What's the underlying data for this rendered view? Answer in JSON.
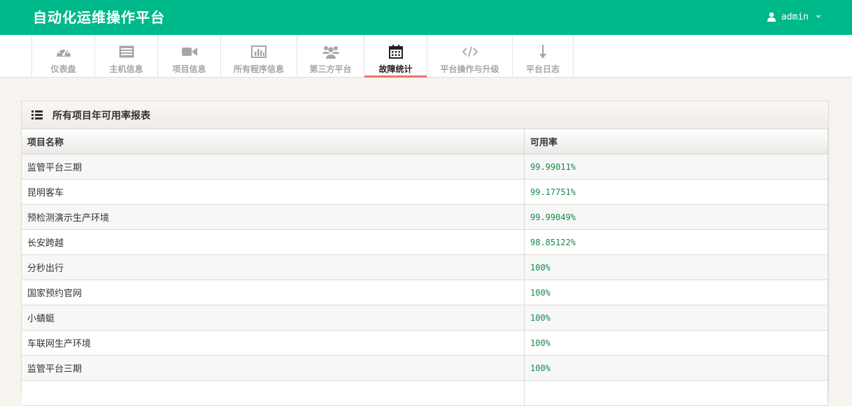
{
  "app": {
    "title": "自动化运维操作平台"
  },
  "user": {
    "name": "admin"
  },
  "nav": {
    "tabs": [
      {
        "label": "仪表盘",
        "icon": "dashboard-icon",
        "active": false
      },
      {
        "label": "主机信息",
        "icon": "list-alt-icon",
        "active": false
      },
      {
        "label": "项目信息",
        "icon": "video-camera-icon",
        "active": false
      },
      {
        "label": "所有程序信息",
        "icon": "bar-chart-icon",
        "active": false
      },
      {
        "label": "第三方平台",
        "icon": "users-icon",
        "active": false
      },
      {
        "label": "故障统计",
        "icon": "calendar-icon",
        "active": true
      },
      {
        "label": "平台操作与升级",
        "icon": "code-icon",
        "active": false
      },
      {
        "label": "平台日志",
        "icon": "arrow-down-icon",
        "active": false
      }
    ]
  },
  "panel": {
    "title": "所有项目年可用率报表",
    "headers": {
      "name": "项目名称",
      "rate": "可用率"
    },
    "rows": [
      {
        "name": "监管平台三期",
        "rate": "99.99011%"
      },
      {
        "name": "昆明客车",
        "rate": "99.17751%"
      },
      {
        "name": "预检测演示生产环境",
        "rate": "99.99049%"
      },
      {
        "name": "长安跨越",
        "rate": "98.85122%"
      },
      {
        "name": "分秒出行",
        "rate": "100%"
      },
      {
        "name": "国家预约官网",
        "rate": "100%"
      },
      {
        "name": "小蜻蜓",
        "rate": "100%"
      },
      {
        "name": "车联网生产环境",
        "rate": "100%"
      },
      {
        "name": "监管平台三期",
        "rate": "100%"
      },
      {
        "name": "",
        "rate": ""
      }
    ]
  },
  "colors": {
    "brand": "#00b98b",
    "active_tab_underline": "#e8756c",
    "rate_text": "#148a4a"
  }
}
